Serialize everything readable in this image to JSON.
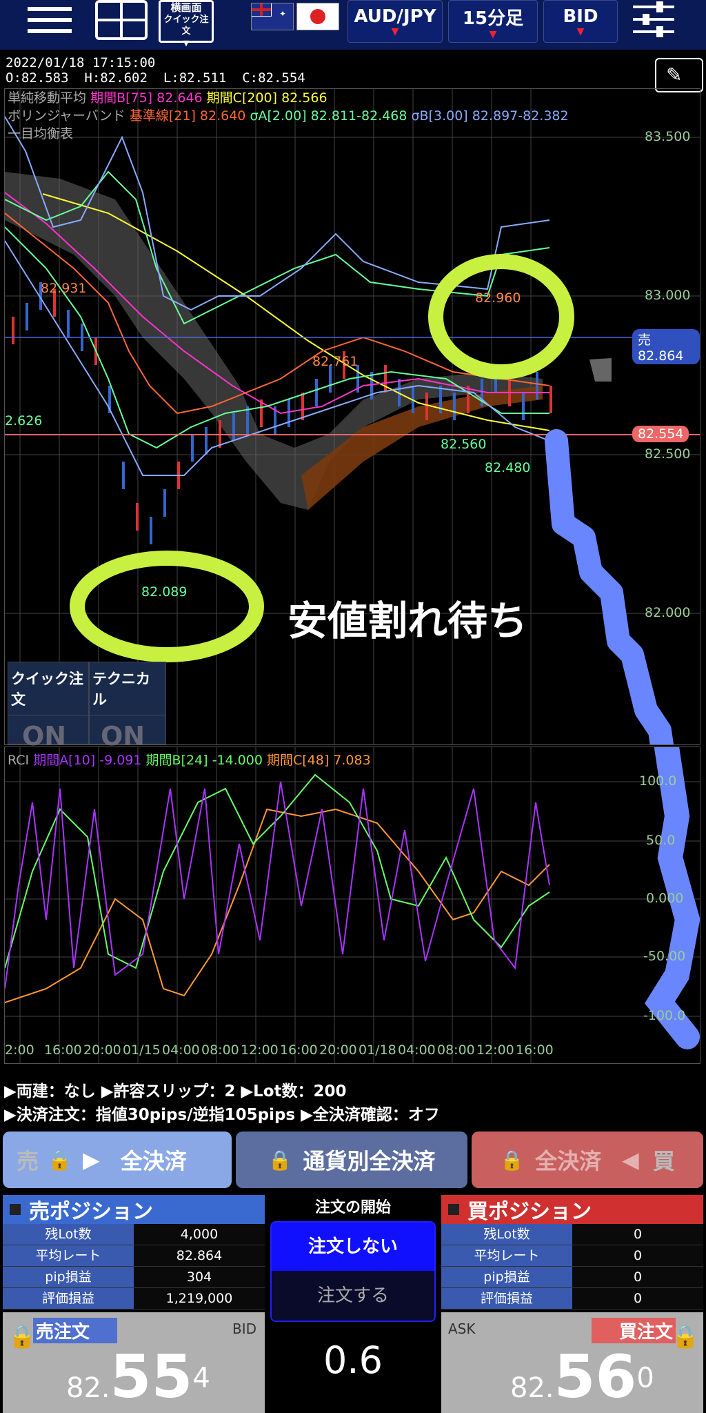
{
  "toolbar": {
    "landscape_label1": "横画面",
    "landscape_label2": "クイック注文",
    "pair": "AUD/JPY",
    "timeframe": "15分足",
    "side": "BID"
  },
  "ohlc": {
    "datetime": "2022/01/18  17:15:00",
    "open": "O:82.583",
    "high": "H:82.602",
    "low": "L:82.511",
    "close": "C:82.554"
  },
  "legend": {
    "sma_name": "単純移動平均",
    "sma_b": "期間B[75] 82.646",
    "sma_c": "期間C[200] 82.566",
    "bb_name": "ボリンジャーバンド",
    "bb_base": "基準線[21] 82.640",
    "bb_a": "σA[2.00] 82.811-82.468",
    "bb_b": "σB[3.00] 82.897-82.382",
    "ichimoku": "一目均衡表"
  },
  "price_axis": {
    "p83500": "83.500",
    "p83000": "83.000",
    "p82500": "82.500",
    "p82000": "82.000",
    "sell_tag": "売82.864",
    "current_tag": "82.554"
  },
  "annotations": {
    "a82931": "82.931",
    "a82761": "82.761",
    "a82626": "2.626",
    "a82960": "82.960",
    "a82560": "82.560",
    "a82480": "82.480",
    "a82089": "82.089",
    "handwritten": "安値割れ待ち"
  },
  "panel": {
    "quick_order": "クイック注文",
    "technical": "テクニカル",
    "quick_on": "ON",
    "tech_on": "ON"
  },
  "rci": {
    "name": "RCI",
    "a": "期間A[10] -9.091",
    "b": "期間B[24] -14.000",
    "c": "期間C[48] 7.083",
    "y100": "100.0",
    "y50": "50.0",
    "y0": "0.000",
    "ym50": "-50.00",
    "ym100": "-100.0"
  },
  "time_axis": [
    "2:00",
    "16:00",
    "20:00",
    "01/15",
    "04:00",
    "08:00",
    "12:00",
    "16:00",
    "20:00",
    "01/18",
    "04:00",
    "08:00",
    "12:00",
    "16:00"
  ],
  "info": {
    "line1": "▶両建：なし ▶許容スリップ：2 ▶Lot数：200",
    "line2": "▶決済注文：指値30pips/逆指105pips ▶全決済確認：オフ"
  },
  "close_buttons": {
    "sell_side": "売",
    "sell_all": "全決済",
    "by_currency": "通貨別全決済",
    "buy_all": "全決済",
    "buy_side": "買"
  },
  "sell_position": {
    "title": "売ポジション",
    "rows": [
      {
        "k": "残Lot数",
        "v": "4,000"
      },
      {
        "k": "平均レート",
        "v": "82.864"
      },
      {
        "k": "pip損益",
        "v": "304"
      },
      {
        "k": "評価損益",
        "v": "1,219,000"
      }
    ]
  },
  "order": {
    "title": "注文の開始",
    "no_order": "注文しない",
    "do_order": "注文する",
    "spread": "0.6"
  },
  "buy_position": {
    "title": "買ポジション",
    "rows": [
      {
        "k": "残Lot数",
        "v": "0"
      },
      {
        "k": "平均レート",
        "v": "0"
      },
      {
        "k": "pip損益",
        "v": "0"
      },
      {
        "k": "評価損益",
        "v": "0"
      }
    ]
  },
  "sell_quote": {
    "label": "売注文",
    "side": "BID",
    "big1": "82.",
    "big2": "55",
    "big3": "4"
  },
  "buy_quote": {
    "label": "買注文",
    "side": "ASK",
    "big1": "82.",
    "big2": "56",
    "big3": "0"
  }
}
